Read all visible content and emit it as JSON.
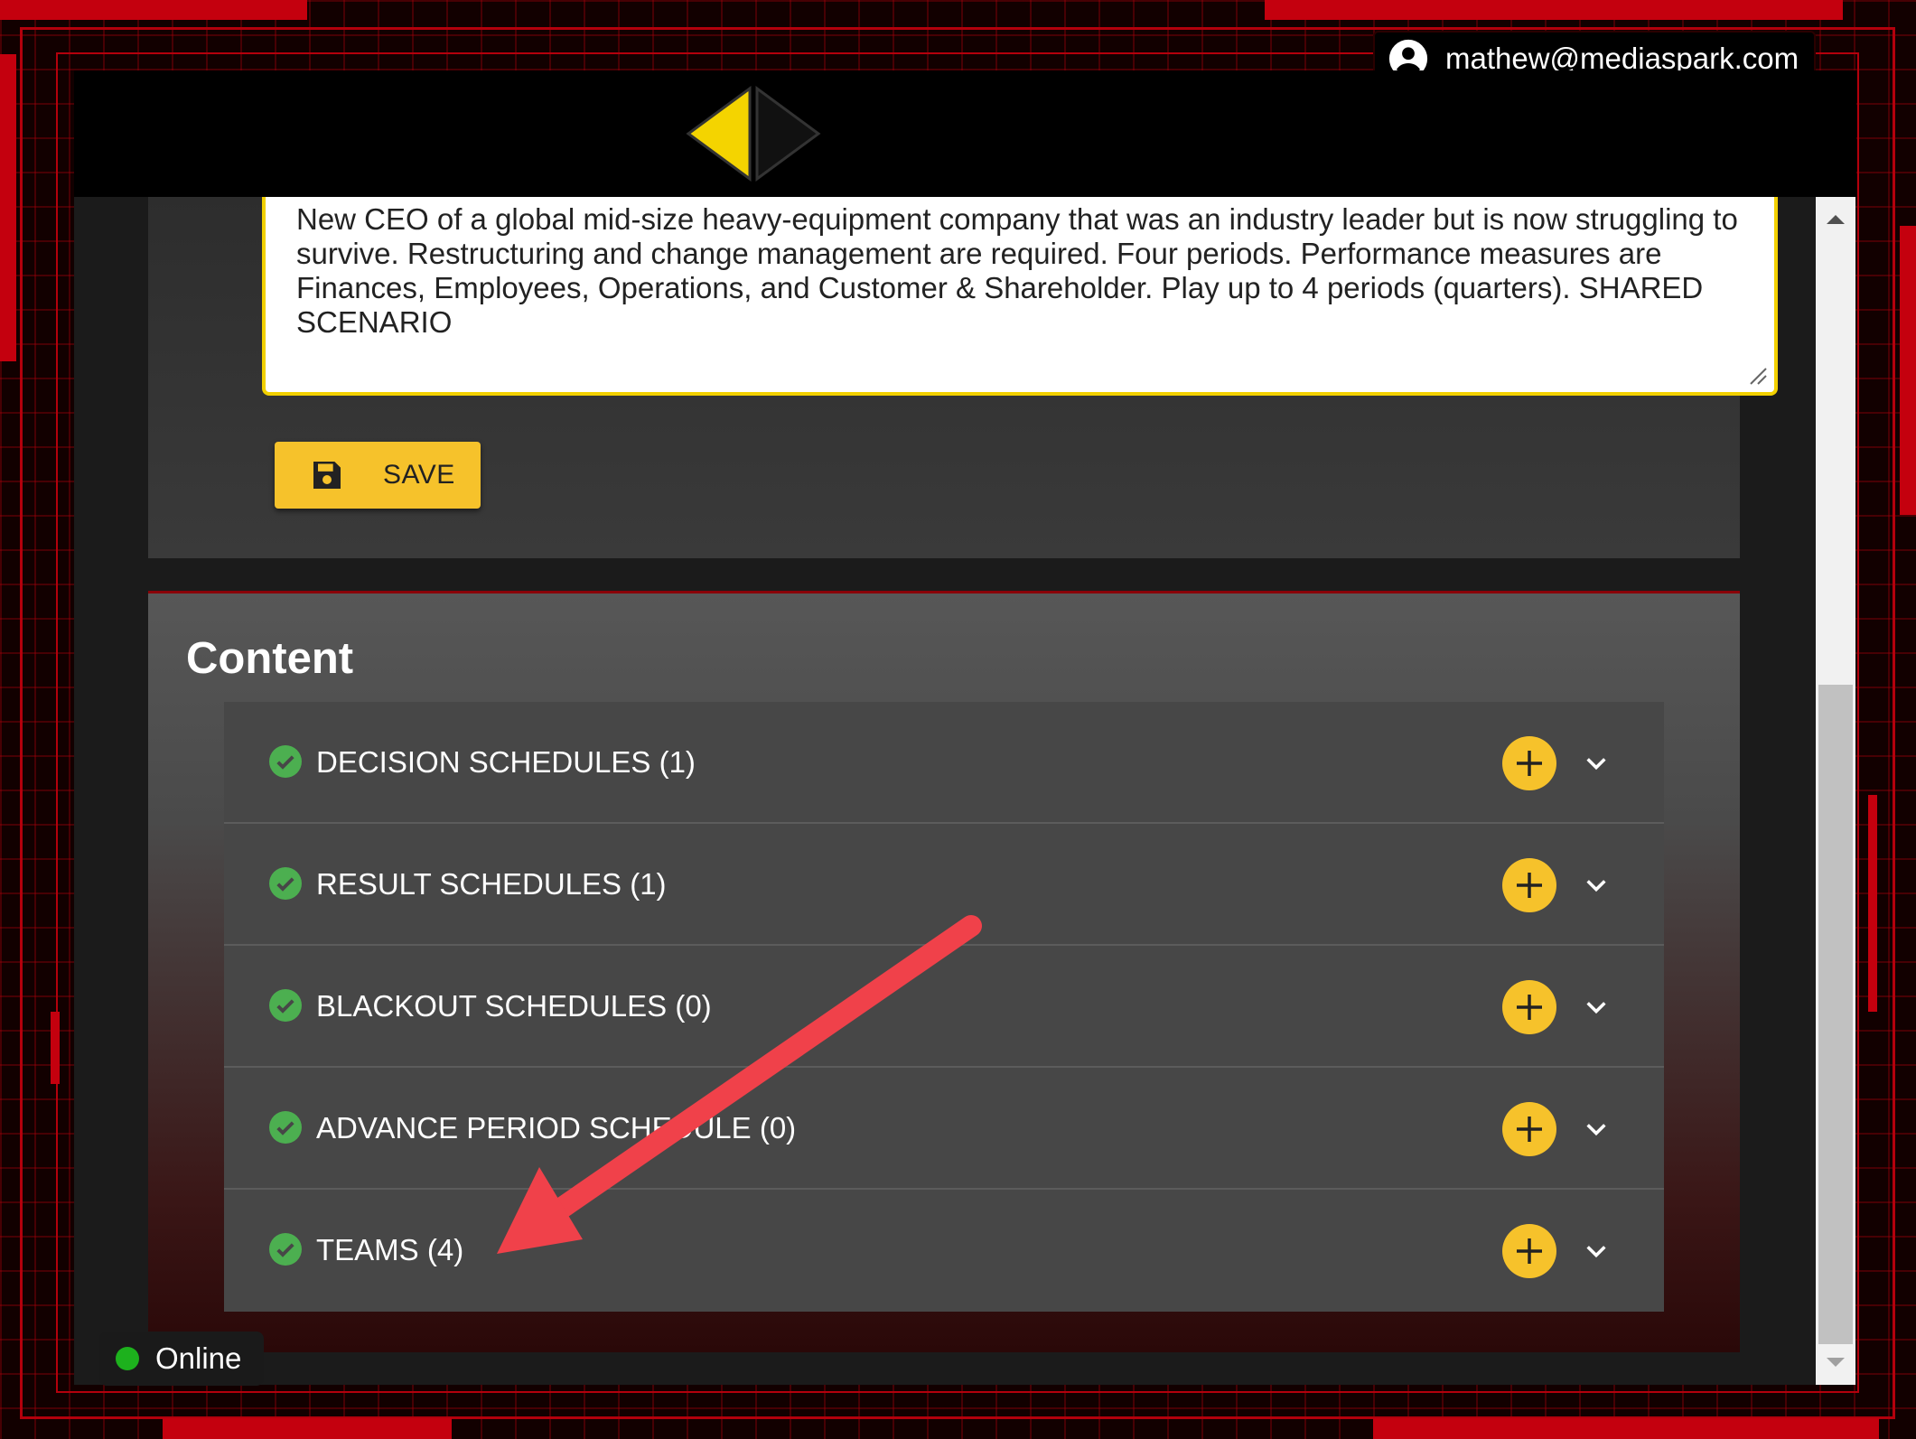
{
  "user": {
    "email": "mathew@mediaspark.com",
    "icon": "account-circle-icon"
  },
  "nav": {
    "prev_icon": "triangle-left-icon",
    "next_icon": "triangle-right-icon"
  },
  "scenario": {
    "description": "New CEO of a global mid-size heavy-equipment company that was an industry leader but is now struggling to survive. Restructuring and change management are required.  Four periods.  Performance measures are Finances, Employees, Operations, and Customer & Shareholder. Play up to 4 periods (quarters). SHARED SCENARIO",
    "save_label": "SAVE",
    "save_icon": "floppy-disk-icon"
  },
  "content": {
    "title": "Content",
    "items": [
      {
        "label": "DECISION SCHEDULES (1)"
      },
      {
        "label": "RESULT SCHEDULES (1)"
      },
      {
        "label": "BLACKOUT SCHEDULES (0)"
      },
      {
        "label": "ADVANCE PERIOD SCHEDULE (0)"
      },
      {
        "label": "TEAMS (4)"
      }
    ]
  },
  "status": {
    "label": "Online",
    "color": "#1db11d"
  },
  "colors": {
    "accent": "#f6c22b",
    "frame": "#b3000c",
    "check": "#4caf50",
    "annotation_arrow": "#f0414a"
  }
}
